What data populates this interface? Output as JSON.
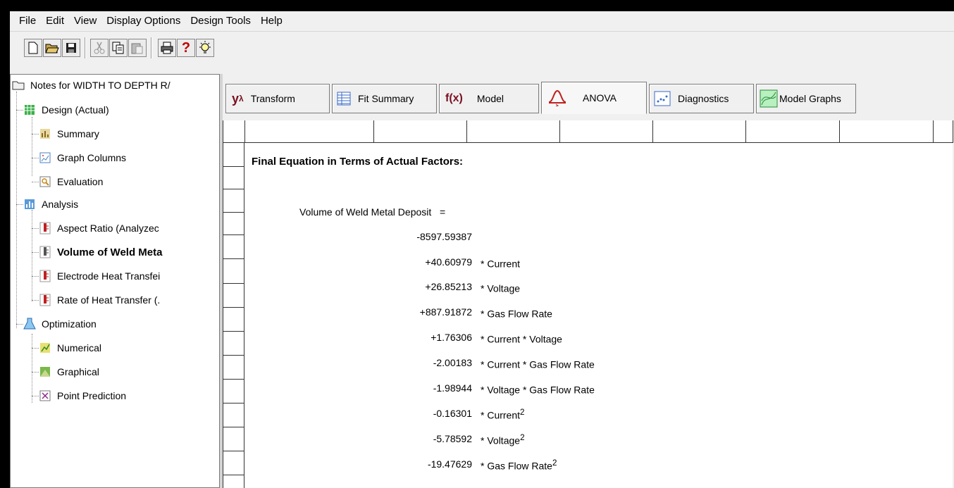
{
  "menu": [
    "File",
    "Edit",
    "View",
    "Display Options",
    "Design Tools",
    "Help"
  ],
  "toolbar": {
    "icons": [
      "new-icon",
      "open-icon",
      "save-icon",
      "cut-icon",
      "copy-icon",
      "paste-icon",
      "print-icon",
      "help-icon",
      "tip-icon"
    ],
    "help_glyph": "?"
  },
  "tree": {
    "root": "Notes for WIDTH TO DEPTH R/",
    "design": "Design (Actual)",
    "summary": "Summary",
    "graph_columns": "Graph Columns",
    "evaluation": "Evaluation",
    "analysis": "Analysis",
    "aspect_ratio": "Aspect Ratio (Analyzec",
    "volume": "Volume of Weld Meta",
    "electrode": "Electrode Heat Transfei",
    "rate": "Rate of Heat Transfer (.",
    "optimization": "Optimization",
    "numerical": "Numerical",
    "graphical": "Graphical",
    "point_prediction": "Point Prediction"
  },
  "tabs": {
    "transform": "Transform",
    "transform_symbol": "y",
    "transform_sup": "λ",
    "fit_summary": "Fit Summary",
    "model_symbol": "f(x)",
    "model": "Model",
    "anova": "ANOVA",
    "diagnostics": "Diagnostics",
    "model_graphs": "Model Graphs"
  },
  "equation": {
    "title": "Final Equation in Terms of Actual Factors:",
    "response": "Volume of Weld Metal Deposit",
    "equals": "=",
    "intercept": "-8597.59387",
    "terms": [
      {
        "coef": "+40.60979",
        "term": "* Current",
        "sup": ""
      },
      {
        "coef": "+26.85213",
        "term": "* Voltage",
        "sup": ""
      },
      {
        "coef": "+887.91872",
        "term": "* Gas Flow Rate",
        "sup": ""
      },
      {
        "coef": "+1.76306",
        "term": "* Current * Voltage",
        "sup": ""
      },
      {
        "coef": "-2.00183",
        "term": "* Current * Gas Flow Rate",
        "sup": ""
      },
      {
        "coef": "-1.98944",
        "term": "* Voltage * Gas Flow Rate",
        "sup": ""
      },
      {
        "coef": "-0.16301",
        "term": "* Current",
        "sup": "2"
      },
      {
        "coef": "-5.78592",
        "term": "* Voltage",
        "sup": "2"
      },
      {
        "coef": "-19.47629",
        "term": "* Gas Flow Rate",
        "sup": "2"
      }
    ]
  }
}
